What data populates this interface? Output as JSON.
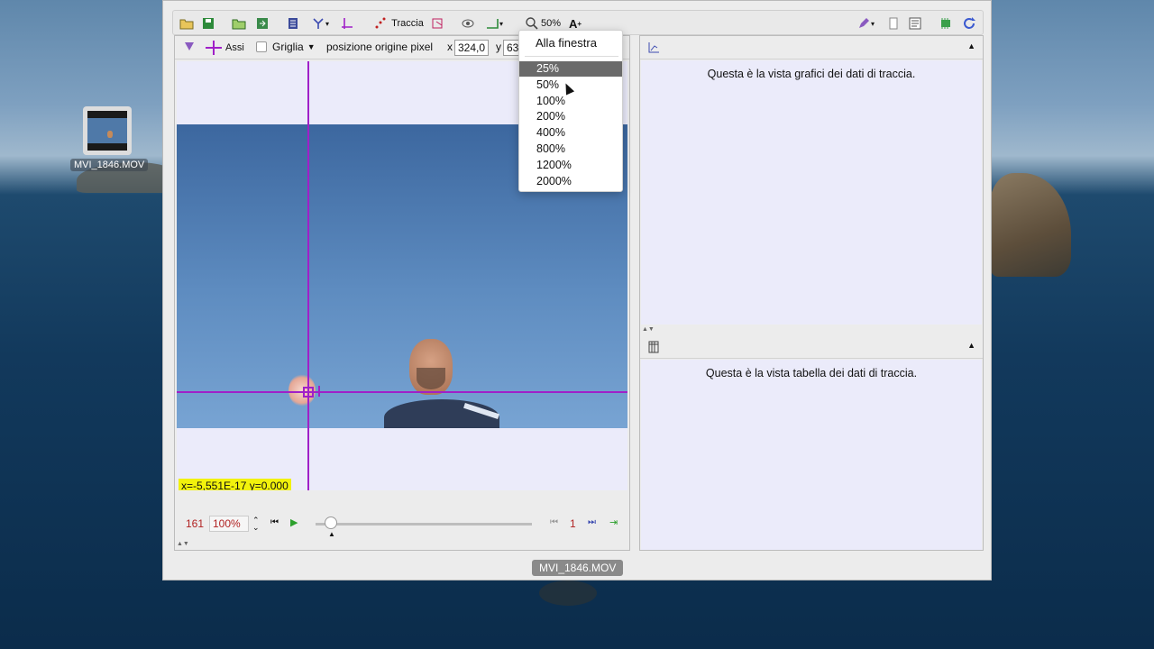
{
  "desktop": {
    "file_icon_label": "MVI_1846.MOV"
  },
  "toolbar": {
    "track_label": "Traccia",
    "zoom_label": "50%"
  },
  "track_bar": {
    "axes_label": "Assi",
    "grid_label": "Griglia",
    "origin_label": "posizione origine pixel",
    "x_label": "x",
    "x_value": "324,0",
    "y_label": "y",
    "y_value": "63"
  },
  "video": {
    "coord_readout": "x=-5,551E-17  y=0.000"
  },
  "player": {
    "frame_number": "161",
    "rate": "100%",
    "step_number": "1"
  },
  "right_panel": {
    "plot_message": "Questa è la vista grafici dei dati di traccia.",
    "table_message": "Questa è la vista tabella dei dati di traccia."
  },
  "status": {
    "file_label": "MVI_1846.MOV"
  },
  "zoom_menu": {
    "fit_label": "Alla finestra",
    "options": [
      "25%",
      "50%",
      "100%",
      "200%",
      "400%",
      "800%",
      "1200%",
      "2000%"
    ],
    "selected_index": 0
  },
  "colors": {
    "axis": "#a020c8",
    "readout_bg": "#f2f20c",
    "frame_text": "#b12222"
  }
}
